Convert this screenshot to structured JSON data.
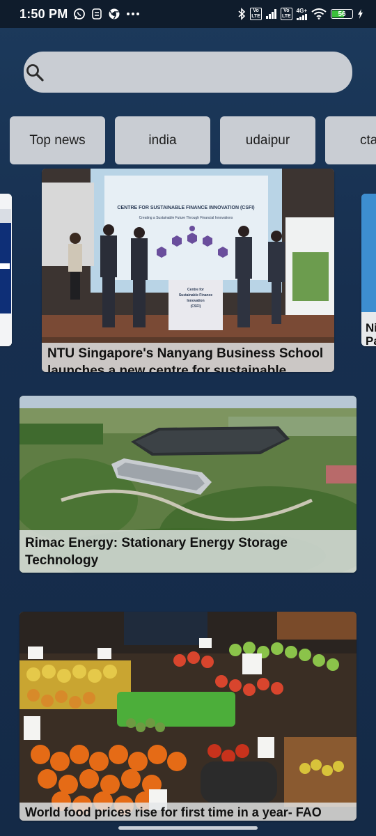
{
  "status_bar": {
    "time": "1:50 PM",
    "volte1": "Vo\nLTE",
    "volte2": "Vo\nLTE",
    "net_type": "4G+",
    "battery": "56"
  },
  "search": {
    "placeholder": "",
    "value": "",
    "icon": "search-icon"
  },
  "chips": [
    {
      "label": "Top news"
    },
    {
      "label": "india"
    },
    {
      "label": "udaipur"
    },
    {
      "label": "cta"
    }
  ],
  "carousel": {
    "center": {
      "title": "NTU Singapore's Nanyang Business School launches a new centre for sustainable"
    },
    "right_peek": {
      "title": "Ni\nPa"
    }
  },
  "stage_screen": {
    "heading": "CENTRE FOR SUSTAINABLE FINANCE INNOVATION (CSFI)",
    "subheading": "Creating a Sustainable Future Through Financial Innovations",
    "podium": "Centre for\nSustainable Finance\nInnovation\n(CSFI)"
  },
  "articles": [
    {
      "title": "Rimac Energy: Stationary Energy Storage Technology"
    },
    {
      "title": "World food prices rise for first time in a year- FAO"
    }
  ],
  "colors": {
    "background_top": "#1c3a5c",
    "background_bottom": "#142a47",
    "chip_bg": "#c9cdd3",
    "status_bar_bg": "#0f1c2c"
  }
}
